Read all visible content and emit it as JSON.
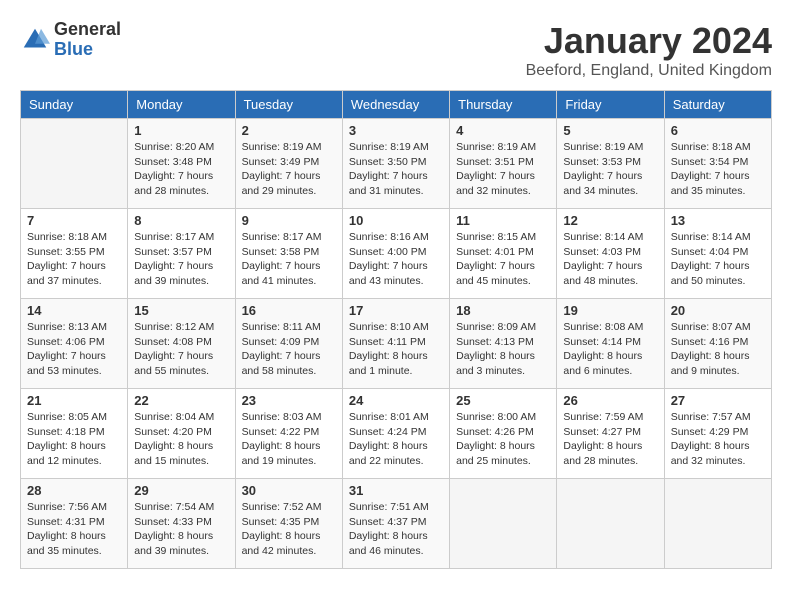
{
  "header": {
    "logo_general": "General",
    "logo_blue": "Blue",
    "month_title": "January 2024",
    "location": "Beeford, England, United Kingdom"
  },
  "days_of_week": [
    "Sunday",
    "Monday",
    "Tuesday",
    "Wednesday",
    "Thursday",
    "Friday",
    "Saturday"
  ],
  "weeks": [
    [
      {
        "day": "",
        "empty": true
      },
      {
        "day": "1",
        "sunrise": "Sunrise: 8:20 AM",
        "sunset": "Sunset: 3:48 PM",
        "daylight": "Daylight: 7 hours and 28 minutes."
      },
      {
        "day": "2",
        "sunrise": "Sunrise: 8:19 AM",
        "sunset": "Sunset: 3:49 PM",
        "daylight": "Daylight: 7 hours and 29 minutes."
      },
      {
        "day": "3",
        "sunrise": "Sunrise: 8:19 AM",
        "sunset": "Sunset: 3:50 PM",
        "daylight": "Daylight: 7 hours and 31 minutes."
      },
      {
        "day": "4",
        "sunrise": "Sunrise: 8:19 AM",
        "sunset": "Sunset: 3:51 PM",
        "daylight": "Daylight: 7 hours and 32 minutes."
      },
      {
        "day": "5",
        "sunrise": "Sunrise: 8:19 AM",
        "sunset": "Sunset: 3:53 PM",
        "daylight": "Daylight: 7 hours and 34 minutes."
      },
      {
        "day": "6",
        "sunrise": "Sunrise: 8:18 AM",
        "sunset": "Sunset: 3:54 PM",
        "daylight": "Daylight: 7 hours and 35 minutes."
      }
    ],
    [
      {
        "day": "7",
        "sunrise": "Sunrise: 8:18 AM",
        "sunset": "Sunset: 3:55 PM",
        "daylight": "Daylight: 7 hours and 37 minutes."
      },
      {
        "day": "8",
        "sunrise": "Sunrise: 8:17 AM",
        "sunset": "Sunset: 3:57 PM",
        "daylight": "Daylight: 7 hours and 39 minutes."
      },
      {
        "day": "9",
        "sunrise": "Sunrise: 8:17 AM",
        "sunset": "Sunset: 3:58 PM",
        "daylight": "Daylight: 7 hours and 41 minutes."
      },
      {
        "day": "10",
        "sunrise": "Sunrise: 8:16 AM",
        "sunset": "Sunset: 4:00 PM",
        "daylight": "Daylight: 7 hours and 43 minutes."
      },
      {
        "day": "11",
        "sunrise": "Sunrise: 8:15 AM",
        "sunset": "Sunset: 4:01 PM",
        "daylight": "Daylight: 7 hours and 45 minutes."
      },
      {
        "day": "12",
        "sunrise": "Sunrise: 8:14 AM",
        "sunset": "Sunset: 4:03 PM",
        "daylight": "Daylight: 7 hours and 48 minutes."
      },
      {
        "day": "13",
        "sunrise": "Sunrise: 8:14 AM",
        "sunset": "Sunset: 4:04 PM",
        "daylight": "Daylight: 7 hours and 50 minutes."
      }
    ],
    [
      {
        "day": "14",
        "sunrise": "Sunrise: 8:13 AM",
        "sunset": "Sunset: 4:06 PM",
        "daylight": "Daylight: 7 hours and 53 minutes."
      },
      {
        "day": "15",
        "sunrise": "Sunrise: 8:12 AM",
        "sunset": "Sunset: 4:08 PM",
        "daylight": "Daylight: 7 hours and 55 minutes."
      },
      {
        "day": "16",
        "sunrise": "Sunrise: 8:11 AM",
        "sunset": "Sunset: 4:09 PM",
        "daylight": "Daylight: 7 hours and 58 minutes."
      },
      {
        "day": "17",
        "sunrise": "Sunrise: 8:10 AM",
        "sunset": "Sunset: 4:11 PM",
        "daylight": "Daylight: 8 hours and 1 minute."
      },
      {
        "day": "18",
        "sunrise": "Sunrise: 8:09 AM",
        "sunset": "Sunset: 4:13 PM",
        "daylight": "Daylight: 8 hours and 3 minutes."
      },
      {
        "day": "19",
        "sunrise": "Sunrise: 8:08 AM",
        "sunset": "Sunset: 4:14 PM",
        "daylight": "Daylight: 8 hours and 6 minutes."
      },
      {
        "day": "20",
        "sunrise": "Sunrise: 8:07 AM",
        "sunset": "Sunset: 4:16 PM",
        "daylight": "Daylight: 8 hours and 9 minutes."
      }
    ],
    [
      {
        "day": "21",
        "sunrise": "Sunrise: 8:05 AM",
        "sunset": "Sunset: 4:18 PM",
        "daylight": "Daylight: 8 hours and 12 minutes."
      },
      {
        "day": "22",
        "sunrise": "Sunrise: 8:04 AM",
        "sunset": "Sunset: 4:20 PM",
        "daylight": "Daylight: 8 hours and 15 minutes."
      },
      {
        "day": "23",
        "sunrise": "Sunrise: 8:03 AM",
        "sunset": "Sunset: 4:22 PM",
        "daylight": "Daylight: 8 hours and 19 minutes."
      },
      {
        "day": "24",
        "sunrise": "Sunrise: 8:01 AM",
        "sunset": "Sunset: 4:24 PM",
        "daylight": "Daylight: 8 hours and 22 minutes."
      },
      {
        "day": "25",
        "sunrise": "Sunrise: 8:00 AM",
        "sunset": "Sunset: 4:26 PM",
        "daylight": "Daylight: 8 hours and 25 minutes."
      },
      {
        "day": "26",
        "sunrise": "Sunrise: 7:59 AM",
        "sunset": "Sunset: 4:27 PM",
        "daylight": "Daylight: 8 hours and 28 minutes."
      },
      {
        "day": "27",
        "sunrise": "Sunrise: 7:57 AM",
        "sunset": "Sunset: 4:29 PM",
        "daylight": "Daylight: 8 hours and 32 minutes."
      }
    ],
    [
      {
        "day": "28",
        "sunrise": "Sunrise: 7:56 AM",
        "sunset": "Sunset: 4:31 PM",
        "daylight": "Daylight: 8 hours and 35 minutes."
      },
      {
        "day": "29",
        "sunrise": "Sunrise: 7:54 AM",
        "sunset": "Sunset: 4:33 PM",
        "daylight": "Daylight: 8 hours and 39 minutes."
      },
      {
        "day": "30",
        "sunrise": "Sunrise: 7:52 AM",
        "sunset": "Sunset: 4:35 PM",
        "daylight": "Daylight: 8 hours and 42 minutes."
      },
      {
        "day": "31",
        "sunrise": "Sunrise: 7:51 AM",
        "sunset": "Sunset: 4:37 PM",
        "daylight": "Daylight: 8 hours and 46 minutes."
      },
      {
        "day": "",
        "empty": true
      },
      {
        "day": "",
        "empty": true
      },
      {
        "day": "",
        "empty": true
      }
    ]
  ]
}
